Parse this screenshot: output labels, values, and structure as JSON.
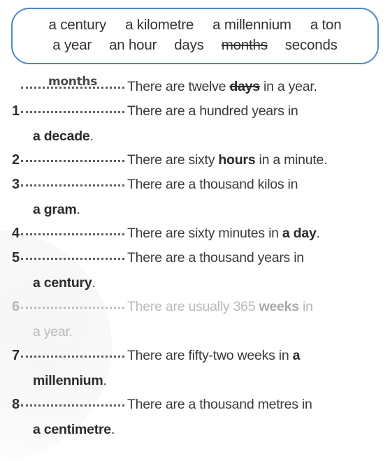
{
  "wordbank": {
    "rows": [
      [
        {
          "text": "a century",
          "used": false
        },
        {
          "text": "a kilometre",
          "used": false
        },
        {
          "text": "a millennium",
          "used": false
        },
        {
          "text": "a ton",
          "used": false
        }
      ],
      [
        {
          "text": "a year",
          "used": false
        },
        {
          "text": "an hour",
          "used": false
        },
        {
          "text": "days",
          "used": false
        },
        {
          "text": "months",
          "used": true
        },
        {
          "text": "seconds",
          "used": false
        }
      ]
    ]
  },
  "example": {
    "number": "",
    "answer": "months",
    "sentence_pre": "There are twelve ",
    "struck_word": "days",
    "sentence_post": " in a year."
  },
  "items": [
    {
      "number": "1",
      "answer": "",
      "pre": "There are a hundred years in",
      "bold": "",
      "post": "",
      "continuation_bold": "a decade",
      "continuation_post": ".",
      "faded": false
    },
    {
      "number": "2",
      "answer": "",
      "pre": "There are sixty ",
      "bold": "hours",
      "post": " in a minute.",
      "continuation_bold": "",
      "continuation_post": "",
      "faded": false
    },
    {
      "number": "3",
      "answer": "",
      "pre": "There are a thousand kilos in",
      "bold": "",
      "post": "",
      "continuation_bold": "a gram",
      "continuation_post": ".",
      "faded": false
    },
    {
      "number": "4",
      "answer": "",
      "pre": "There are sixty minutes in ",
      "bold": "a day",
      "post": ".",
      "continuation_bold": "",
      "continuation_post": "",
      "faded": false
    },
    {
      "number": "5",
      "answer": "",
      "pre": "There are a thousand years in",
      "bold": "",
      "post": "",
      "continuation_bold": "a century",
      "continuation_post": ".",
      "faded": false
    },
    {
      "number": "6",
      "answer": "",
      "pre": "There are usually 365 ",
      "bold": "weeks",
      "post": " in",
      "continuation_bold": "",
      "continuation_post": "a year.",
      "faded": true
    },
    {
      "number": "7",
      "answer": "",
      "pre": "There are fifty-two weeks in ",
      "bold": "a",
      "post": "",
      "continuation_bold": "millennium",
      "continuation_post": ".",
      "faded": false
    },
    {
      "number": "8",
      "answer": "",
      "pre": "There are a thousand metres in",
      "bold": "",
      "post": "",
      "continuation_bold": "a centimetre",
      "continuation_post": ".",
      "faded": false
    }
  ],
  "colors": {
    "box_border": "#4a8ac9",
    "text": "#3a3a3c",
    "faded_text": "#b9b9bb",
    "dotted_line": "#5d5d60"
  }
}
